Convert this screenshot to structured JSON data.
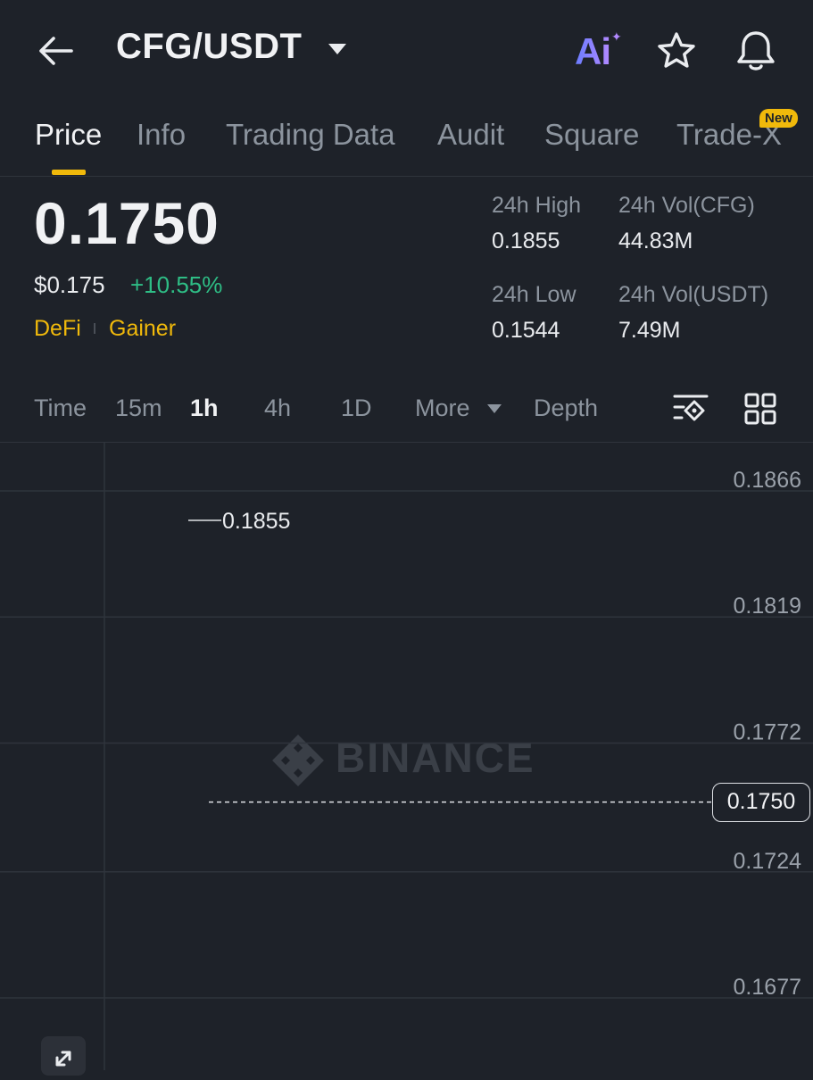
{
  "header": {
    "pair": "CFG/USDT",
    "ai_label": "Ai"
  },
  "tabs": [
    {
      "label": "Price",
      "active": true
    },
    {
      "label": "Info"
    },
    {
      "label": "Trading Data"
    },
    {
      "label": "Audit"
    },
    {
      "label": "Square"
    },
    {
      "label": "Trade-X",
      "badge": "New"
    }
  ],
  "price": {
    "last": "0.1750",
    "usd": "$0.175",
    "change_pct": "+10.55%",
    "tags": [
      "DeFi",
      "Gainer"
    ]
  },
  "stats": {
    "high_label": "24h High",
    "high_value": "0.1855",
    "low_label": "24h Low",
    "low_value": "0.1544",
    "vol_base_label": "24h Vol(CFG)",
    "vol_base_value": "44.83M",
    "vol_quote_label": "24h Vol(USDT)",
    "vol_quote_value": "7.49M"
  },
  "intervals": {
    "items": [
      "Time",
      "15m",
      "1h",
      "4h",
      "1D",
      "More",
      "Depth"
    ],
    "active": "1h"
  },
  "chart": {
    "watermark": "BINANCE",
    "high_annotation": "0.1855",
    "current_price": "0.1750"
  },
  "chart_data": {
    "type": "candlestick",
    "interval": "1h",
    "y_ticks": [
      0.1866,
      0.1819,
      0.1772,
      0.1724,
      0.1677
    ],
    "y_tick_labels": [
      "0.1866",
      "0.1819",
      "0.1772",
      "0.1724",
      "0.1677"
    ],
    "current_price": 0.175,
    "high_marker": 0.1855,
    "candles": [],
    "colors": {
      "up": "#5ac38a",
      "down": "#e15a6b",
      "grid": "#2f343c",
      "text": "#9aa1aa"
    }
  }
}
